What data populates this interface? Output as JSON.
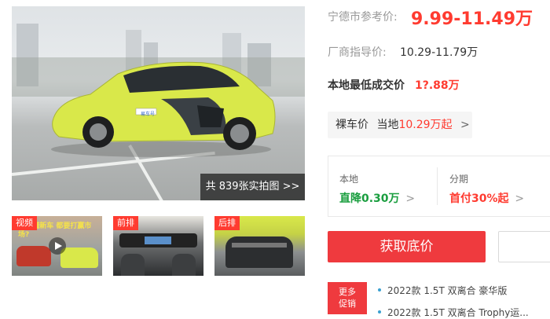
{
  "gallery": {
    "photo_count_label": "共 839张实拍图 >>",
    "thumbs": [
      {
        "tag": "视频",
        "caption": "T 看懂新车 都要打赢市场?"
      },
      {
        "tag": "前排"
      },
      {
        "tag": "后排"
      }
    ],
    "plate_text": "易车号"
  },
  "price": {
    "ref_label": "宁德市参考价:",
    "ref_value": "9.99-11.49万",
    "guide_label": "厂商指导价:",
    "guide_value": "10.29-11.79万",
    "lowest_label": "本地最低成交价",
    "lowest_value": "1?.88万"
  },
  "bare_price": {
    "label": "裸车价",
    "local": "当地",
    "value": "10.29万起",
    "chevron": ">"
  },
  "deal": {
    "local_label": "本地",
    "local_value": "直降0.30万",
    "installment_label": "分期",
    "installment_value": "首付30%起",
    "chevron": ">"
  },
  "actions": {
    "get_price": "获取底价"
  },
  "promo": {
    "more_label_line1": "更多",
    "more_label_line2": "促销",
    "items": [
      "2022款 1.5T 双离合 豪华版",
      "2022款 1.5T 双离合 Trophy运..."
    ]
  },
  "colors": {
    "accent_red": "#ef3a3e",
    "price_red": "#ff3b30",
    "installment_red": "#ff3b30",
    "deal_green": "#1a9e3f",
    "car_yellow": "#d9e84a"
  }
}
